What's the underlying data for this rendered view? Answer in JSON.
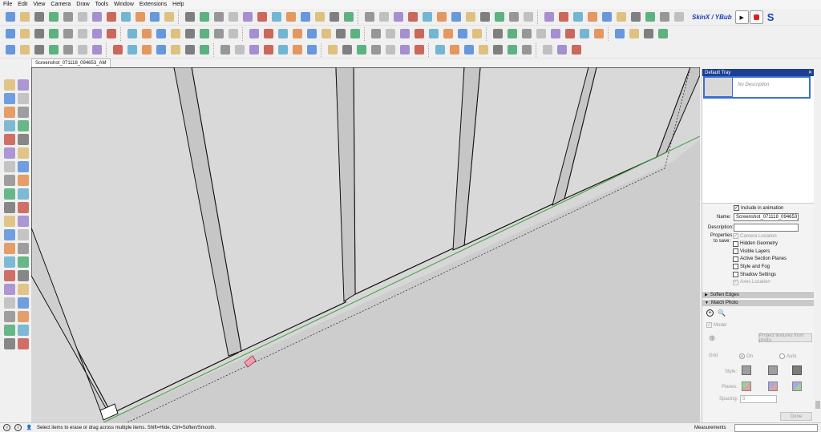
{
  "menu": [
    "File",
    "Edit",
    "View",
    "Camera",
    "Draw",
    "Tools",
    "Window",
    "Extensions",
    "Help"
  ],
  "toolbar": {
    "skinx_label": "SkinX / YBub"
  },
  "tab": {
    "label": "Screenshot_071118_094653_AM"
  },
  "tray": {
    "title": "Default Tray",
    "scene_description": "No Description",
    "include_animation": "Include in animation",
    "name_label": "Name:",
    "name_value": "Screenshot_071118_094653_",
    "description_label": "Description:",
    "properties_label": "Properties",
    "to_save_label": "to save:",
    "properties": [
      {
        "label": "Camera Location",
        "checked": "✓",
        "disabled": true
      },
      {
        "label": "Hidden Geometry",
        "checked": "",
        "disabled": false
      },
      {
        "label": "Visible Layers",
        "checked": "",
        "disabled": false
      },
      {
        "label": "Active Section Planes",
        "checked": "",
        "disabled": false
      },
      {
        "label": "Style and Fog",
        "checked": "",
        "disabled": false
      },
      {
        "label": "Shadow Settings",
        "checked": "",
        "disabled": false
      },
      {
        "label": "Axes Location",
        "checked": "✓",
        "disabled": true
      }
    ],
    "soften_edges": "Soften Edges",
    "match_photo": "Match Photo",
    "model_label": "Model",
    "project_button": "Project textures from photo",
    "grid_label": "Grid",
    "grid_on": "On",
    "grid_auto": "Auto",
    "style_label": "Style:",
    "planes_label": "Planes:",
    "spacing_label": "Spacing:",
    "spacing_value": "5'",
    "done_button": "Done"
  },
  "status": {
    "text": "Select items to erase or drag across multiple items. Shift=Hide, Ctrl=Soften/Smooth.",
    "measurements_label": "Measurements"
  },
  "colors": {
    "accent": "#1c3f94",
    "edge_green": "#3ea03e",
    "wall": "#d6d6d6"
  }
}
